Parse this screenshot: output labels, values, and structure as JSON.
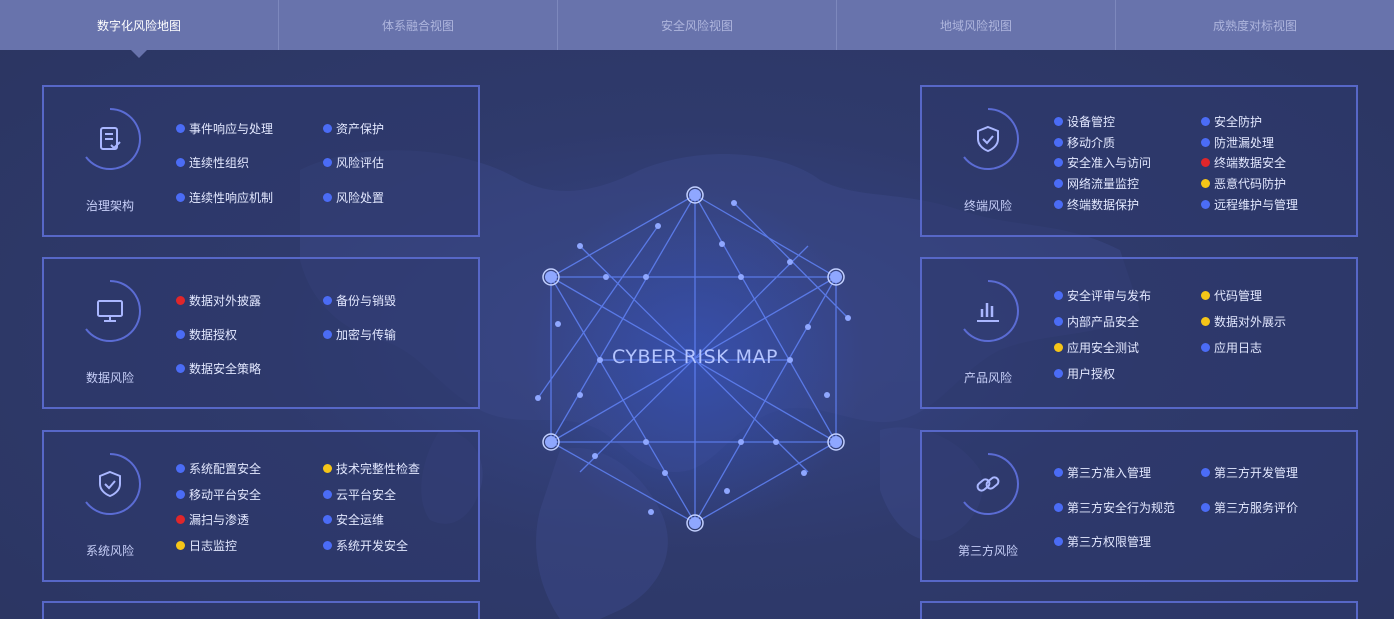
{
  "tabs": [
    {
      "label": "数字化风险地图",
      "active": true
    },
    {
      "label": "体系融合视图",
      "active": false
    },
    {
      "label": "安全风险视图",
      "active": false
    },
    {
      "label": "地域风险视图",
      "active": false
    },
    {
      "label": "成熟度对标视图",
      "active": false
    }
  ],
  "center_title": "CYBER RISK MAP",
  "cards": {
    "governance": {
      "title": "治理架构",
      "icon": "document-check-icon",
      "items": [
        {
          "label": "事件响应与处理",
          "status": "blue"
        },
        {
          "label": "资产保护",
          "status": "blue"
        },
        {
          "label": "连续性组织",
          "status": "blue"
        },
        {
          "label": "风险评估",
          "status": "blue"
        },
        {
          "label": "连续性响应机制",
          "status": "blue"
        },
        {
          "label": "风险处置",
          "status": "blue"
        }
      ]
    },
    "data": {
      "title": "数据风险",
      "icon": "monitor-icon",
      "items": [
        {
          "label": "数据对外披露",
          "status": "red"
        },
        {
          "label": "备份与销毁",
          "status": "blue"
        },
        {
          "label": "数据授权",
          "status": "blue"
        },
        {
          "label": "加密与传输",
          "status": "blue"
        },
        {
          "label": "数据安全策略",
          "status": "blue"
        }
      ]
    },
    "system": {
      "title": "系统风险",
      "icon": "shield-check-icon",
      "items": [
        {
          "label": "系统配置安全",
          "status": "blue"
        },
        {
          "label": "技术完整性检查",
          "status": "yellow"
        },
        {
          "label": "移动平台安全",
          "status": "blue"
        },
        {
          "label": "云平台安全",
          "status": "blue"
        },
        {
          "label": "漏扫与渗透",
          "status": "red"
        },
        {
          "label": "安全运维",
          "status": "blue"
        },
        {
          "label": "日志监控",
          "status": "yellow"
        },
        {
          "label": "系统开发安全",
          "status": "blue"
        }
      ]
    },
    "endpoint": {
      "title": "终端风险",
      "icon": "shield-check-icon",
      "items": [
        {
          "label": "设备管控",
          "status": "blue"
        },
        {
          "label": "安全防护",
          "status": "blue"
        },
        {
          "label": "移动介质",
          "status": "blue"
        },
        {
          "label": "防泄漏处理",
          "status": "blue"
        },
        {
          "label": "安全准入与访问",
          "status": "blue"
        },
        {
          "label": "终端数据安全",
          "status": "red"
        },
        {
          "label": "网络流量监控",
          "status": "blue"
        },
        {
          "label": "恶意代码防护",
          "status": "yellow"
        },
        {
          "label": "终端数据保护",
          "status": "blue"
        },
        {
          "label": "远程维护与管理",
          "status": "blue"
        }
      ]
    },
    "product": {
      "title": "产品风险",
      "icon": "bar-chart-icon",
      "items": [
        {
          "label": "安全评审与发布",
          "status": "blue"
        },
        {
          "label": "代码管理",
          "status": "yellow"
        },
        {
          "label": "内部产品安全",
          "status": "blue"
        },
        {
          "label": "数据对外展示",
          "status": "yellow"
        },
        {
          "label": "应用安全测试",
          "status": "yellow"
        },
        {
          "label": "应用日志",
          "status": "blue"
        },
        {
          "label": "用户授权",
          "status": "blue"
        }
      ]
    },
    "third": {
      "title": "第三方风险",
      "icon": "link-icon",
      "items": [
        {
          "label": "第三方准入管理",
          "status": "blue"
        },
        {
          "label": "第三方开发管理",
          "status": "blue"
        },
        {
          "label": "第三方安全行为规范",
          "status": "blue"
        },
        {
          "label": "第三方服务评价",
          "status": "blue"
        },
        {
          "label": "第三方权限管理",
          "status": "blue"
        }
      ]
    }
  },
  "colors": {
    "accent": "#5767c7",
    "blue": "#4b6cf5",
    "red": "#e0262a",
    "yellow": "#f5c518"
  }
}
